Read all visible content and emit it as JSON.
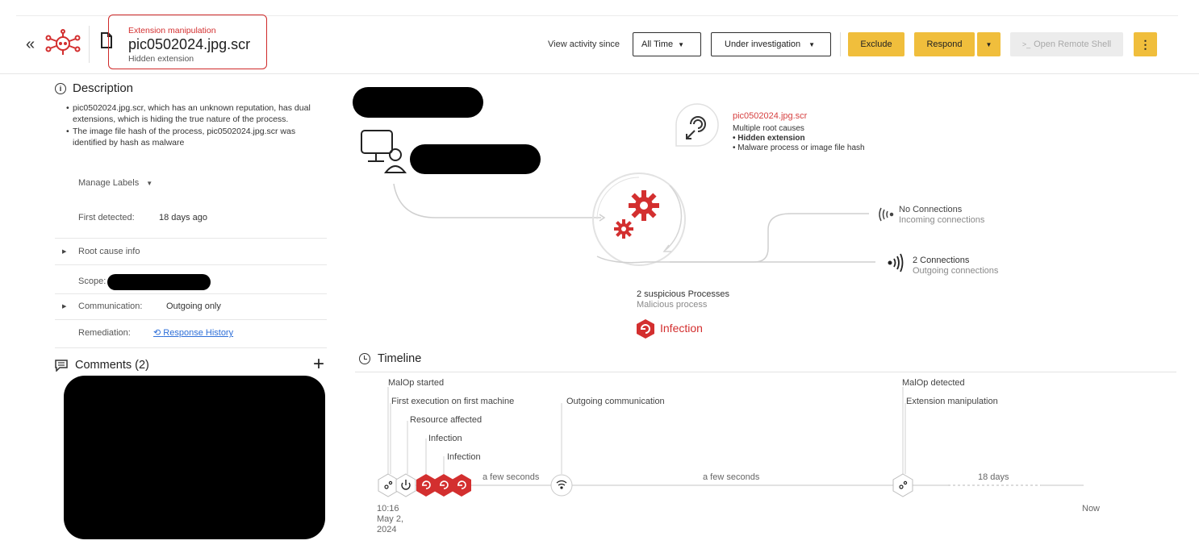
{
  "header": {
    "malop_type": "Extension manipulation",
    "file_name": "pic0502024.jpg.scr",
    "subtitle": "Hidden extension",
    "view_activity_label": "View activity since",
    "time_filter": "All Time",
    "status_filter": "Under investigation",
    "exclude_label": "Exclude",
    "respond_label": "Respond",
    "remote_shell_label": "Open Remote Shell",
    "collapse_glyph": "«",
    "remote_shell_prompt": ">_",
    "more_glyph": "⋮"
  },
  "description": {
    "heading": "Description",
    "info_glyph": "i",
    "items": [
      "pic0502024.jpg.scr, which has an unknown reputation, has dual extensions, which is hiding the true nature of the process.",
      "The image file hash of the process, pic0502024.jpg.scr was identified by hash as malware"
    ],
    "manage_labels": "Manage Labels"
  },
  "details": {
    "first_detected_label": "First detected:",
    "first_detected_value": "18 days ago",
    "root_cause_label": "Root cause info",
    "scope_label": "Scope:",
    "communication_label": "Communication:",
    "communication_value": "Outgoing only",
    "remediation_label": "Remediation:",
    "response_history_glyph": "⟲",
    "response_history": "Response History"
  },
  "comments": {
    "heading": "Comments (2)",
    "add_glyph": "+"
  },
  "graph": {
    "root_cause_file": "pic0502024.jpg.scr",
    "root_cause_line1": "Multiple root causes",
    "root_cause_bullets": [
      "Hidden extension",
      "Malware process or image file hash"
    ],
    "incoming_title": "No Connections",
    "incoming_sub": "Incoming connections",
    "outgoing_title": "2 Connections",
    "outgoing_sub": "Outgoing connections",
    "suspicious_title": "2 suspicious Processes",
    "suspicious_sub": "Malicious process",
    "infection_label": "Infection"
  },
  "timeline": {
    "heading": "Timeline",
    "events": [
      "MalOp started",
      "First execution on first machine",
      "Resource affected",
      "Infection",
      "Infection",
      "Outgoing communication",
      "MalOp detected",
      "Extension manipulation"
    ],
    "durations": [
      "a few seconds",
      "a few seconds",
      "18 days"
    ],
    "start_time": "10:16",
    "start_date": "May 2,",
    "start_year": "2024",
    "end_label": "Now"
  },
  "colors": {
    "accent_red": "#d32f2f",
    "button_yellow": "#f0be3c",
    "link_blue": "#2e6fd8"
  },
  "icons": [
    "malop-network-icon",
    "file-icon",
    "info-icon",
    "comment-icon",
    "clock-icon",
    "fingerprint-icon",
    "user-computer-icon",
    "gears-icon",
    "incoming-signal-icon",
    "outgoing-signal-icon",
    "infection-icon",
    "power-icon",
    "wifi-icon"
  ]
}
